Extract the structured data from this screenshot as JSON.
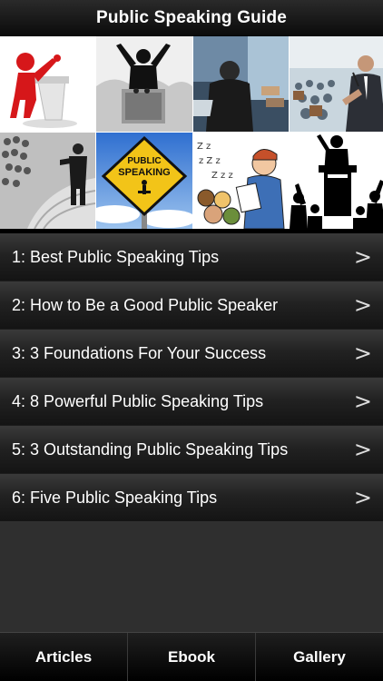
{
  "header": {
    "title": "Public Speaking Guide"
  },
  "gallery": {
    "images": [
      {
        "icon": "podium-figure-icon"
      },
      {
        "icon": "crowd-speaker-icon"
      },
      {
        "icon": "conference-speaker-icon"
      },
      {
        "icon": "hall-speaker-icon"
      },
      {
        "icon": "audience-speaker-icon"
      },
      {
        "icon": "public-speaking-sign-icon",
        "sign_text_1": "PUBLIC",
        "sign_text_2": "SPEAKING"
      },
      {
        "icon": "cartoon-speaker-icon"
      },
      {
        "icon": "silhouette-speaker-icon"
      }
    ]
  },
  "articles": [
    {
      "label": "1: Best Public Speaking Tips"
    },
    {
      "label": "2: How to Be a Good Public Speaker"
    },
    {
      "label": "3: 3 Foundations For Your Success"
    },
    {
      "label": "4: 8 Powerful Public Speaking Tips"
    },
    {
      "label": "5: 3 Outstanding Public Speaking Tips"
    },
    {
      "label": "6: Five Public Speaking Tips"
    }
  ],
  "chevron": ">",
  "tabs": [
    {
      "label": "Articles"
    },
    {
      "label": "Ebook"
    },
    {
      "label": "Gallery"
    }
  ]
}
